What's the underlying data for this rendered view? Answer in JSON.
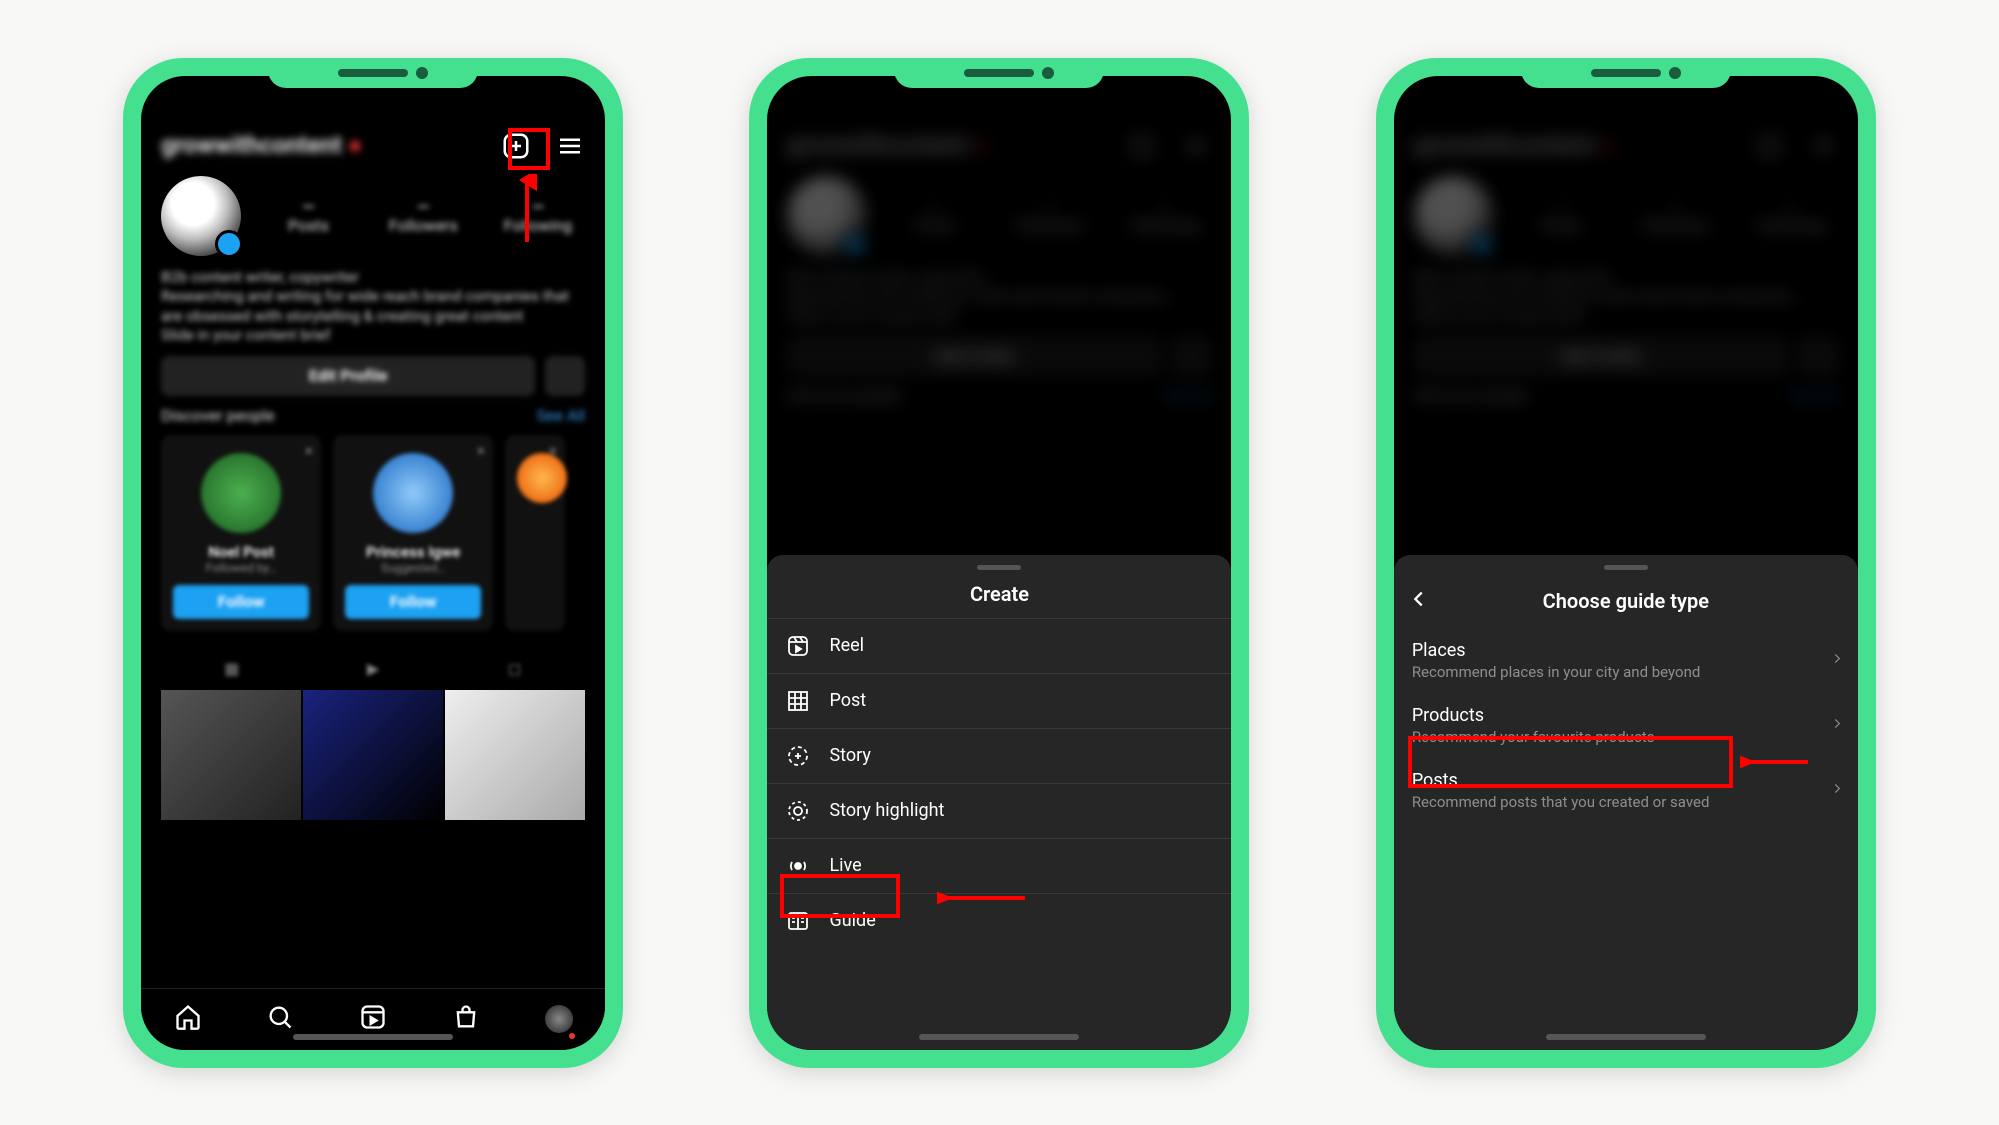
{
  "colors": {
    "accent": "#44e08f",
    "highlight": "#ff0000",
    "ig_blue": "#1da1f2",
    "sheet_bg": "#262626"
  },
  "phone1": {
    "username": "growwithcontent",
    "edit_label": "Edit Profile",
    "discover_label": "Discover people",
    "see_all": "See All",
    "follow_label": "Follow",
    "icons": {
      "create": "create-icon",
      "menu": "hamburger-icon"
    }
  },
  "phone2": {
    "sheet_title": "Create",
    "items": [
      {
        "icon": "reel-icon",
        "label": "Reel"
      },
      {
        "icon": "post-grid-icon",
        "label": "Post"
      },
      {
        "icon": "story-icon",
        "label": "Story"
      },
      {
        "icon": "highlight-icon",
        "label": "Story highlight"
      },
      {
        "icon": "live-icon",
        "label": "Live"
      },
      {
        "icon": "guide-icon",
        "label": "Guide"
      }
    ]
  },
  "phone3": {
    "sheet_title": "Choose guide type",
    "items": [
      {
        "title": "Places",
        "subtitle": "Recommend places in your city and beyond"
      },
      {
        "title": "Products",
        "subtitle": "Recommend your favourite products"
      },
      {
        "title": "Posts",
        "subtitle": "Recommend posts that you created or saved"
      }
    ]
  }
}
